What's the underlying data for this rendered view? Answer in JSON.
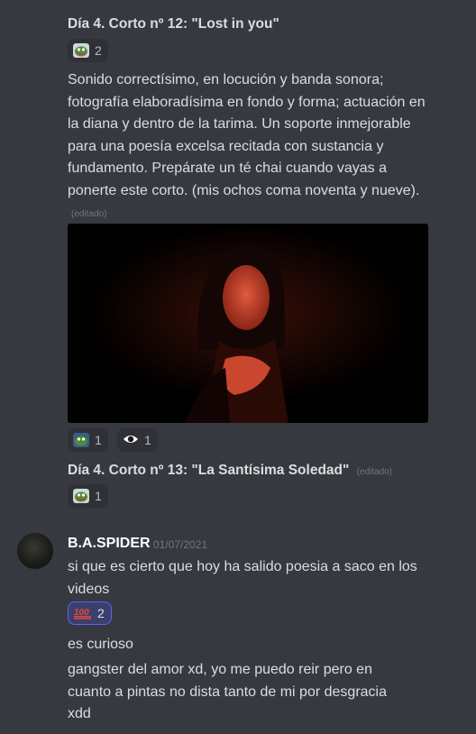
{
  "messages": [
    {
      "title": "Día 4. Corto nº 12: \"Lost in you\"",
      "reactions": [
        {
          "emoji": "pepe-icon",
          "count": "2"
        }
      ],
      "text": "Sonido correctísimo, en locución y banda sonora; fotografía elaboradísima en fondo y forma; actuación en la diana y dentro de la tarima. Un soporte inmejorable para una poesía excelsa recitada con sustancia y fundamento. Prepárate un té chai cuando vayas a ponerte este corto. (mis ochos coma noventa y nueve).",
      "edited": "(editado)",
      "media_reactions": [
        {
          "emoji": "pepe-icon",
          "count": "1"
        },
        {
          "emoji": "eye-icon",
          "count": "1"
        }
      ]
    },
    {
      "title": "Día 4. Corto nº 13: \"La Santísima Soledad\"",
      "edited": "(editado)",
      "reactions": [
        {
          "emoji": "pepe-icon",
          "count": "1"
        }
      ]
    }
  ],
  "user_message": {
    "username": "B.A.SPIDER",
    "timestamp": "01/07/2021",
    "lines": [
      "si que es cierto que hoy ha salido poesia a saco en los videos",
      "es curioso",
      "gangster del amor xd, yo me puedo reir pero en cuanto a pintas no dista tanto de mi por desgracia xdd"
    ],
    "reaction": {
      "emoji": "100",
      "count": "2"
    }
  },
  "colors": {
    "background": "#36393f",
    "reaction_bg": "#2f3136",
    "reaction_active": "#5865f2",
    "text": "#dcddde",
    "muted": "#72767d"
  }
}
